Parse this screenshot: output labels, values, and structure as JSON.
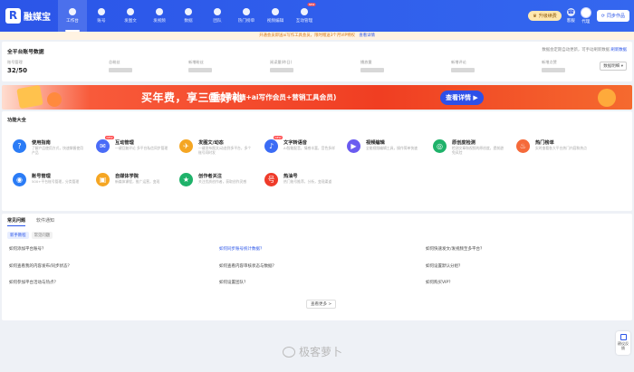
{
  "logo": {
    "mark": "R",
    "text": "融媒宝"
  },
  "nav": [
    {
      "label": "工作台",
      "icon": "home-icon",
      "active": true
    },
    {
      "label": "账号",
      "icon": "user-icon"
    },
    {
      "label": "发图文",
      "icon": "send-icon"
    },
    {
      "label": "发视频",
      "icon": "video-icon"
    },
    {
      "label": "数据",
      "icon": "chart-icon"
    },
    {
      "label": "团队",
      "icon": "team-icon"
    },
    {
      "label": "热门榜单",
      "icon": "fire-icon"
    },
    {
      "label": "视频编辑",
      "icon": "edit-icon"
    },
    {
      "label": "互动管理",
      "icon": "chat-icon",
      "badge": "NEW"
    }
  ],
  "header": {
    "upgrade_label": "升级续费",
    "mobile_label": "客服",
    "user_label": "代理",
    "sync_label": "同步作品"
  },
  "notice": {
    "text": "开通会员即送ai写作工具会员，限时赠送3个月VIP特权",
    "link": "查看详情"
  },
  "account": {
    "title": "全平台账号数据",
    "note": "数据会定期自动更新，可手动刷新数据",
    "note_link": "刷新数据",
    "stats": [
      {
        "label": "账号管理",
        "value": "32/50"
      },
      {
        "label": "总粉丝",
        "value": ""
      },
      {
        "label": "新增粉丝",
        "value": ""
      },
      {
        "label": "阅读量(昨日)",
        "value": ""
      },
      {
        "label": "播放量",
        "value": ""
      },
      {
        "label": "新增评论",
        "value": ""
      },
      {
        "label": "新增点赞",
        "value": ""
      }
    ],
    "detail_button": "数据明细"
  },
  "banner": {
    "main": "买年费，享三重好礼",
    "sub": "(送运营秘籍+ai写作会员+营销工具会员)",
    "button": "查看详情 ▶"
  },
  "functions": {
    "title": "功能大全",
    "items": [
      {
        "name": "使用指南",
        "desc": "了解产品使用方式，快速掌握使用产品",
        "color": "#2b7cf6",
        "glyph": "?",
        "icon": "guide-icon"
      },
      {
        "name": "互动管理",
        "desc": "一键回复评论 多平台私信同步管理",
        "color": "#4a6cf7",
        "glyph": "✉",
        "icon": "chat-icon",
        "badge": "NEW"
      },
      {
        "name": "发图文/动态",
        "desc": "一键发布图文/动态到多平台，多个账号同时发",
        "color": "#f5a623",
        "glyph": "✈",
        "icon": "send-icon"
      },
      {
        "name": "文字转语音",
        "desc": "AI智能配音，情感丰富，音色多样",
        "color": "#3b6cf5",
        "glyph": "♪",
        "icon": "voice-icon",
        "badge": "NEW"
      },
      {
        "name": "视频编辑",
        "desc": "全能视频编辑工具，操作简单快速",
        "color": "#6a5bf0",
        "glyph": "▶",
        "icon": "video-edit-icon"
      },
      {
        "name": "原创度检测",
        "desc": "检测文章和视频的原创度，提前避免风险",
        "color": "#1fb26a",
        "glyph": "◎",
        "icon": "check-icon"
      },
      {
        "name": "热门榜单",
        "desc": "实时查看各大平台热门内容和热点",
        "color": "#f56a3a",
        "glyph": "♨",
        "icon": "fire-icon"
      },
      {
        "name": "账号管理",
        "desc": "500+平台账号管理，分类管理",
        "color": "#2b7cf6",
        "glyph": "◉",
        "icon": "account-icon"
      },
      {
        "name": "自媒体学院",
        "desc": "新媒体课程，推广运营，变现",
        "color": "#f5a623",
        "glyph": "▣",
        "icon": "academy-icon"
      },
      {
        "name": "创作者关注",
        "desc": "关注优质创作者，获取创作灵感",
        "color": "#1fb26a",
        "glyph": "★",
        "icon": "creator-icon"
      },
      {
        "name": "热油号",
        "desc": "热门账号推荐，分析，变现渠道",
        "color": "#ef3b2a",
        "glyph": "号",
        "icon": "hot-account-icon"
      }
    ]
  },
  "faq": {
    "tabs": [
      "常见问题",
      "软件通知"
    ],
    "sub_tabs": [
      "新手教程",
      "常见问题"
    ],
    "questions": [
      "如何添加平台账号？",
      "如何同步账号统计数据？",
      "如何快速发文/发视频至多平台？",
      "如何查看我的内容发布/同步状态？",
      "如何查看内容审核状态与数据？",
      "如何设置默认分组？",
      "如何参加平台活动与热点？",
      "如何设置团队？",
      "如何购买VIP？"
    ],
    "more": "查看更多 >"
  },
  "feedback": "建议反馈",
  "watermark": "极客萝卜"
}
